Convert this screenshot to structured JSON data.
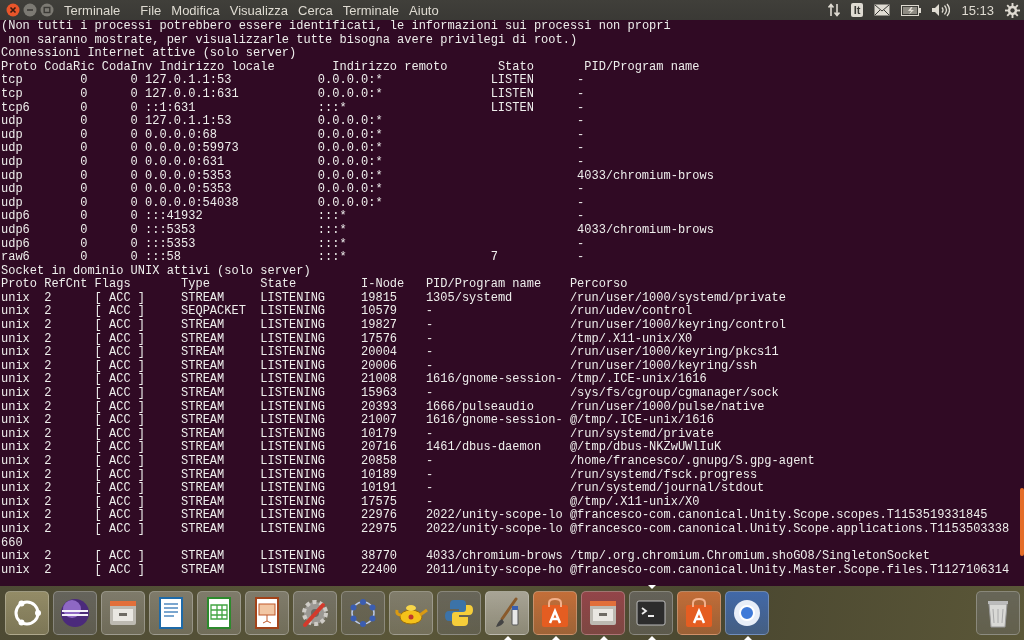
{
  "top_panel": {
    "window_buttons": [
      {
        "kind": "close"
      },
      {
        "kind": "minimize"
      },
      {
        "kind": "maximize"
      }
    ],
    "app_title": "Terminale",
    "menus": [
      "File",
      "Modifica",
      "Visualizza",
      "Cerca",
      "Terminale",
      "Aiuto"
    ],
    "keyboard_layout": "It",
    "clock": "15:13"
  },
  "terminal": {
    "notice_lines": [
      "(Non tutti i processi potrebbero essere identificati, le informazioni sui processi non propri",
      " non saranno mostrate, per visualizzarle tutte bisogna avere privilegi di root.)"
    ],
    "internet": {
      "title": "Connessioni Internet attive (solo server)",
      "columns": [
        "Proto",
        "CodaRic",
        "CodaInv",
        "Indirizzo locale",
        "Indirizzo remoto",
        "Stato",
        "PID/Program name"
      ],
      "rows": [
        {
          "proto": "tcp",
          "recv_q": "0",
          "send_q": "0",
          "local": "127.0.1.1:53",
          "foreign": "0.0.0.0:*",
          "state": "LISTEN",
          "program": "-"
        },
        {
          "proto": "tcp",
          "recv_q": "0",
          "send_q": "0",
          "local": "127.0.0.1:631",
          "foreign": "0.0.0.0:*",
          "state": "LISTEN",
          "program": "-"
        },
        {
          "proto": "tcp6",
          "recv_q": "0",
          "send_q": "0",
          "local": "::1:631",
          "foreign": ":::*",
          "state": "LISTEN",
          "program": "-"
        },
        {
          "proto": "udp",
          "recv_q": "0",
          "send_q": "0",
          "local": "127.0.1.1:53",
          "foreign": "0.0.0.0:*",
          "program": "-"
        },
        {
          "proto": "udp",
          "recv_q": "0",
          "send_q": "0",
          "local": "0.0.0.0:68",
          "foreign": "0.0.0.0:*",
          "program": "-"
        },
        {
          "proto": "udp",
          "recv_q": "0",
          "send_q": "0",
          "local": "0.0.0.0:59973",
          "foreign": "0.0.0.0:*",
          "program": "-"
        },
        {
          "proto": "udp",
          "recv_q": "0",
          "send_q": "0",
          "local": "0.0.0.0:631",
          "foreign": "0.0.0.0:*",
          "program": "-"
        },
        {
          "proto": "udp",
          "recv_q": "0",
          "send_q": "0",
          "local": "0.0.0.0:5353",
          "foreign": "0.0.0.0:*",
          "program": "4033/chromium-brows"
        },
        {
          "proto": "udp",
          "recv_q": "0",
          "send_q": "0",
          "local": "0.0.0.0:5353",
          "foreign": "0.0.0.0:*",
          "program": "-"
        },
        {
          "proto": "udp",
          "recv_q": "0",
          "send_q": "0",
          "local": "0.0.0.0:54038",
          "foreign": "0.0.0.0:*",
          "program": "-"
        },
        {
          "proto": "udp6",
          "recv_q": "0",
          "send_q": "0",
          "local": ":::41932",
          "foreign": ":::*",
          "program": "-"
        },
        {
          "proto": "udp6",
          "recv_q": "0",
          "send_q": "0",
          "local": ":::5353",
          "foreign": ":::*",
          "program": "4033/chromium-brows"
        },
        {
          "proto": "udp6",
          "recv_q": "0",
          "send_q": "0",
          "local": ":::5353",
          "foreign": ":::*",
          "program": "-"
        },
        {
          "proto": "raw6",
          "recv_q": "0",
          "send_q": "0",
          "local": ":::58",
          "foreign": ":::*",
          "state": "7",
          "program": "-"
        }
      ]
    },
    "unix": {
      "title": "Socket in dominio UNIX attivi (solo server)",
      "columns": [
        "Proto",
        "RefCnt",
        "Flags",
        "Type",
        "State",
        "I-Node",
        "PID/Program name",
        "Percorso"
      ],
      "rows": [
        {
          "proto": "unix",
          "refcnt": "2",
          "flags": "[ ACC ]",
          "type": "STREAM",
          "state": "LISTENING",
          "inode": "19815",
          "program": "1305/systemd",
          "path": "/run/user/1000/systemd/private"
        },
        {
          "proto": "unix",
          "refcnt": "2",
          "flags": "[ ACC ]",
          "type": "SEQPACKET",
          "state": "LISTENING",
          "inode": "10579",
          "program": "-",
          "path": "/run/udev/control"
        },
        {
          "proto": "unix",
          "refcnt": "2",
          "flags": "[ ACC ]",
          "type": "STREAM",
          "state": "LISTENING",
          "inode": "19827",
          "program": "-",
          "path": "/run/user/1000/keyring/control"
        },
        {
          "proto": "unix",
          "refcnt": "2",
          "flags": "[ ACC ]",
          "type": "STREAM",
          "state": "LISTENING",
          "inode": "17576",
          "program": "-",
          "path": "/tmp/.X11-unix/X0"
        },
        {
          "proto": "unix",
          "refcnt": "2",
          "flags": "[ ACC ]",
          "type": "STREAM",
          "state": "LISTENING",
          "inode": "20004",
          "program": "-",
          "path": "/run/user/1000/keyring/pkcs11"
        },
        {
          "proto": "unix",
          "refcnt": "2",
          "flags": "[ ACC ]",
          "type": "STREAM",
          "state": "LISTENING",
          "inode": "20006",
          "program": "-",
          "path": "/run/user/1000/keyring/ssh"
        },
        {
          "proto": "unix",
          "refcnt": "2",
          "flags": "[ ACC ]",
          "type": "STREAM",
          "state": "LISTENING",
          "inode": "21008",
          "program": "1616/gnome-session-",
          "path": "/tmp/.ICE-unix/1616"
        },
        {
          "proto": "unix",
          "refcnt": "2",
          "flags": "[ ACC ]",
          "type": "STREAM",
          "state": "LISTENING",
          "inode": "15963",
          "program": "-",
          "path": "/sys/fs/cgroup/cgmanager/sock"
        },
        {
          "proto": "unix",
          "refcnt": "2",
          "flags": "[ ACC ]",
          "type": "STREAM",
          "state": "LISTENING",
          "inode": "20393",
          "program": "1666/pulseaudio",
          "path": "/run/user/1000/pulse/native"
        },
        {
          "proto": "unix",
          "refcnt": "2",
          "flags": "[ ACC ]",
          "type": "STREAM",
          "state": "LISTENING",
          "inode": "21007",
          "program": "1616/gnome-session-",
          "path": "@/tmp/.ICE-unix/1616"
        },
        {
          "proto": "unix",
          "refcnt": "2",
          "flags": "[ ACC ]",
          "type": "STREAM",
          "state": "LISTENING",
          "inode": "10179",
          "program": "-",
          "path": "/run/systemd/private"
        },
        {
          "proto": "unix",
          "refcnt": "2",
          "flags": "[ ACC ]",
          "type": "STREAM",
          "state": "LISTENING",
          "inode": "20716",
          "program": "1461/dbus-daemon",
          "path": "@/tmp/dbus-NKZwUWlIuK"
        },
        {
          "proto": "unix",
          "refcnt": "2",
          "flags": "[ ACC ]",
          "type": "STREAM",
          "state": "LISTENING",
          "inode": "20858",
          "program": "-",
          "path": "/home/francesco/.gnupg/S.gpg-agent"
        },
        {
          "proto": "unix",
          "refcnt": "2",
          "flags": "[ ACC ]",
          "type": "STREAM",
          "state": "LISTENING",
          "inode": "10189",
          "program": "-",
          "path": "/run/systemd/fsck.progress"
        },
        {
          "proto": "unix",
          "refcnt": "2",
          "flags": "[ ACC ]",
          "type": "STREAM",
          "state": "LISTENING",
          "inode": "10191",
          "program": "-",
          "path": "/run/systemd/journal/stdout"
        },
        {
          "proto": "unix",
          "refcnt": "2",
          "flags": "[ ACC ]",
          "type": "STREAM",
          "state": "LISTENING",
          "inode": "17575",
          "program": "-",
          "path": "@/tmp/.X11-unix/X0"
        },
        {
          "proto": "unix",
          "refcnt": "2",
          "flags": "[ ACC ]",
          "type": "STREAM",
          "state": "LISTENING",
          "inode": "22976",
          "program": "2022/unity-scope-lo",
          "path": "@francesco-com.canonical.Unity.Scope.scopes.T1153519331845"
        },
        {
          "proto": "unix",
          "refcnt": "2",
          "flags": "[ ACC ]",
          "type": "STREAM",
          "state": "LISTENING",
          "inode": "22975",
          "program": "2022/unity-scope-lo",
          "path": "@francesco-com.canonical.Unity.Scope.applications.T1153503338",
          "continuation": "660"
        },
        {
          "proto": "unix",
          "refcnt": "2",
          "flags": "[ ACC ]",
          "type": "STREAM",
          "state": "LISTENING",
          "inode": "38770",
          "program": "4033/chromium-brows",
          "path": "/tmp/.org.chromium.Chromium.shoGO8/SingletonSocket"
        },
        {
          "proto": "unix",
          "refcnt": "2",
          "flags": "[ ACC ]",
          "type": "STREAM",
          "state": "LISTENING",
          "inode": "22400",
          "program": "2011/unity-scope-ho",
          "path": "@francesco-com.canonical.Unity.Master.Scope.files.T1127106314"
        }
      ]
    }
  },
  "dock": {
    "items": [
      {
        "kind": "dash",
        "running": false,
        "focused": false
      },
      {
        "kind": "sphere",
        "running": false,
        "focused": false
      },
      {
        "kind": "cabinet",
        "running": false,
        "focused": false
      },
      {
        "kind": "document",
        "running": false,
        "focused": false
      },
      {
        "kind": "spreadsheet",
        "running": false,
        "focused": false
      },
      {
        "kind": "presentation",
        "running": false,
        "focused": false
      },
      {
        "kind": "wrench",
        "running": false,
        "focused": false
      },
      {
        "kind": "dotring",
        "running": false,
        "focused": false
      },
      {
        "kind": "lamp",
        "running": false,
        "focused": false
      },
      {
        "kind": "snake",
        "running": false,
        "focused": false
      },
      {
        "kind": "brush",
        "running": true,
        "focused": false
      },
      {
        "kind": "bag",
        "running": true,
        "focused": false
      },
      {
        "kind": "cabinet-red",
        "running": true,
        "focused": false
      },
      {
        "kind": "terminal",
        "running": true,
        "focused": true
      },
      {
        "kind": "bag",
        "running": false,
        "focused": false
      },
      {
        "kind": "globe",
        "running": true,
        "focused": false
      }
    ],
    "trash": {
      "kind": "trash"
    }
  }
}
